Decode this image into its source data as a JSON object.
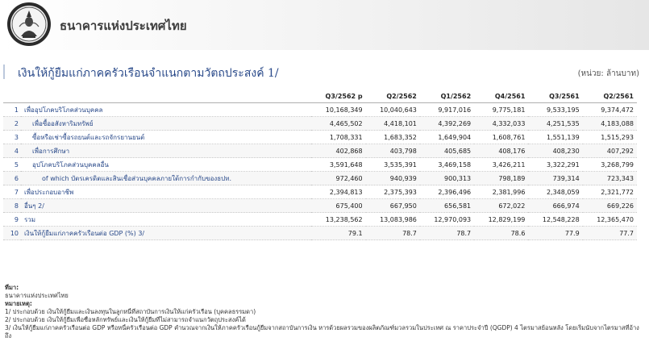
{
  "header": {
    "bank_name": "ธนาคารแห่งประเทศไทย"
  },
  "page": {
    "title": "เงินให้กู้ยืมแก่ภาคครัวเรือนจำแนกตามวัตถประสงค์ 1/",
    "unit": "(หน่วย: ล้านบาท)"
  },
  "table": {
    "columns": [
      "Q3/2562 p",
      "Q2/2562",
      "Q1/2562",
      "Q4/2561",
      "Q3/2561",
      "Q2/2561"
    ],
    "rows": [
      {
        "idx": "1",
        "label": "เพื่ออุปโภคบริโภคส่วนบุคคล",
        "indent": 0,
        "values": [
          "10,168,349",
          "10,040,643",
          "9,917,016",
          "9,775,181",
          "9,533,195",
          "9,374,472"
        ]
      },
      {
        "idx": "2",
        "label": "เพื่อซื้ออสังหาริมทรัพย์",
        "indent": 1,
        "values": [
          "4,465,502",
          "4,418,101",
          "4,392,269",
          "4,332,033",
          "4,251,535",
          "4,183,088"
        ]
      },
      {
        "idx": "3",
        "label": "ซื้อหรือเช่าซื้อรถยนต์และรถจักรยานยนต์",
        "indent": 1,
        "values": [
          "1,708,331",
          "1,683,352",
          "1,649,904",
          "1,608,761",
          "1,551,139",
          "1,515,293"
        ]
      },
      {
        "idx": "4",
        "label": "เพื่อการศึกษา",
        "indent": 1,
        "values": [
          "402,868",
          "403,798",
          "405,685",
          "408,176",
          "408,230",
          "407,292"
        ]
      },
      {
        "idx": "5",
        "label": "อุปโภคบริโภคส่วนบุคคลอื่น",
        "indent": 1,
        "values": [
          "3,591,648",
          "3,535,391",
          "3,469,158",
          "3,426,211",
          "3,322,291",
          "3,268,799"
        ]
      },
      {
        "idx": "6",
        "label": "of which บัตรเครดิตและสินเชื่อส่วนบุคคลภายใต้การกำกับของธปท.",
        "indent": 2,
        "values": [
          "972,460",
          "940,939",
          "900,313",
          "798,189",
          "739,314",
          "723,343"
        ]
      },
      {
        "idx": "7",
        "label": "เพื่อประกอบอาชีพ",
        "indent": 0,
        "values": [
          "2,394,813",
          "2,375,393",
          "2,396,496",
          "2,381,996",
          "2,348,059",
          "2,321,772"
        ]
      },
      {
        "idx": "8",
        "label": "อื่นๆ 2/",
        "indent": 0,
        "values": [
          "675,400",
          "667,950",
          "656,581",
          "672,022",
          "666,974",
          "669,226"
        ]
      },
      {
        "idx": "9",
        "label": "รวม",
        "indent": 0,
        "values": [
          "13,238,562",
          "13,083,986",
          "12,970,093",
          "12,829,199",
          "12,548,228",
          "12,365,470"
        ]
      },
      {
        "idx": "10",
        "label": "เงินให้กู้ยืมแก่ภาคครัวเรือนต่อ GDP (%) 3/",
        "indent": 0,
        "values": [
          "79.1",
          "78.7",
          "78.7",
          "78.6",
          "77.9",
          "77.7"
        ]
      }
    ]
  },
  "notes": {
    "source_label": "ที่มา:",
    "source_text": "ธนาคารแห่งประเทศไทย",
    "remarks_label": "หมายเหตุ:",
    "remarks": [
      "1/ ประกอบด้วย เงินให้กู้ยืมและเงินลงทุนในลูกหนี้ที่สถาบันการเงินให้แก่ครัวเรือน (บุคคลธรรมดา)",
      "2/ ประกอบด้วย เงินให้กู้ยืมเพื่อซื้อหลักทรัพย์และเงินให้กู้ยืมที่ไม่สามารถจำแนกวัตถุประสงค์ได้",
      "3/ เงินให้กู้ยืมแก่ภาคครัวเรือนต่อ GDP หรือหนี้ครัวเรือนต่อ GDP คำนวณจากเงินให้ภาคครัวเรือนกู้ยืมจากสถาบันการเงิน หารด้วยผลรวมของผลิตภัณฑ์มวลรวมในประเทศ ณ ราคาประจำปี (QGDP) 4 ไตรมาสย้อนหลัง โดยเริ่มนับจากไตรมาสที่อ้างถึง"
    ]
  }
}
